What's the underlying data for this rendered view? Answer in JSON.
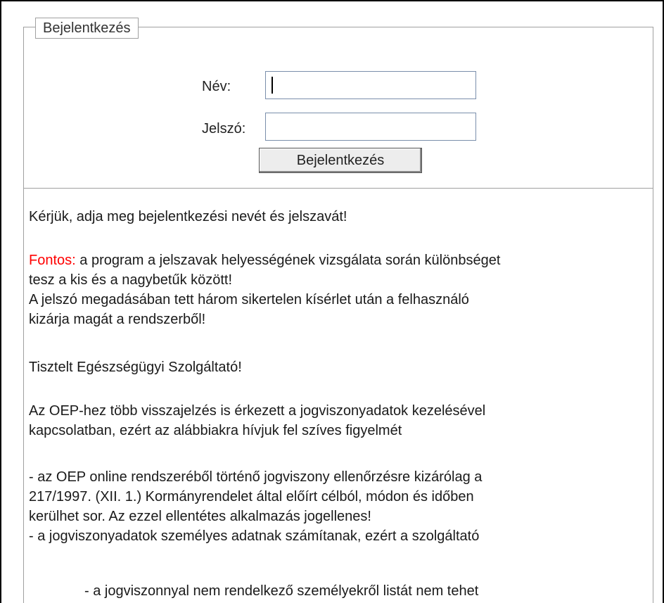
{
  "login": {
    "legend": "Bejelentkezés",
    "name_label": "Név:",
    "password_label": "Jelszó:",
    "name_value": "",
    "password_value": "",
    "submit_label": "Bejelentkezés"
  },
  "info": {
    "prompt": "Kérjük, adja meg bejelentkezési nevét és jelszavát!",
    "important_label": "Fontos:",
    "important_line1": " a program a jelszavak helyességének vizsgálata során különbséget",
    "important_line2": "tesz a kis és a nagybetűk között!",
    "important_line3": "A jelszó megadásában tett három sikertelen kísérlet után a felhasználó",
    "important_line4": "kizárja magát a rendszerből!",
    "greeting": "Tisztelt Egészségügyi Szolgáltató!",
    "notice_line1": "Az OEP-hez több visszajelzés is érkezett a jogviszonyadatok kezelésével",
    "notice_line2": "kapcsolatban, ezért az alábbiakra hívjuk fel szíves figyelmét",
    "rule1_line1": "- az OEP online rendszeréből történő jogviszony ellenőrzésre kizárólag a",
    "rule1_line2": "217/1997. (XII. 1.) Kormányrendelet által előírt célból, módon és időben",
    "rule1_line3": "kerülhet sor. Az ezzel ellentétes alkalmazás jogellenes!",
    "rule2_line1": "- a jogviszonyadatok személyes adatnak számítanak, ezért a szolgáltató",
    "subrule1": "- a jogviszonnyal nem rendelkező személyekről listát nem tehet"
  },
  "colors": {
    "important": "#ff0000",
    "input_border": "#7a8eab",
    "fieldset_border": "#a0a0a0"
  }
}
